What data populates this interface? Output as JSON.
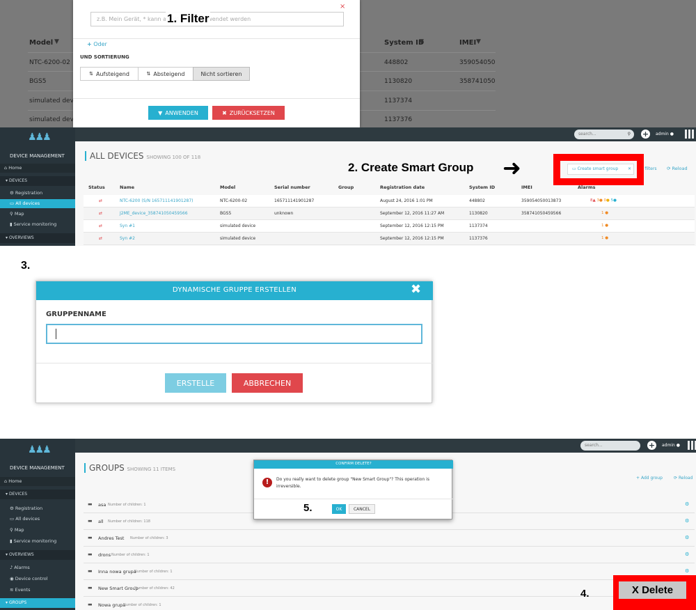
{
  "annotations": {
    "filter": "1. Filter",
    "create": "2. Create Smart Group",
    "step3": "3.",
    "step4": "4.",
    "step5": "5.",
    "delete": "X Delete"
  },
  "p1": {
    "filter_placeholder": "z.B. Mein Gerät, * kann als Wildcard verwendet werden",
    "oder": "Oder",
    "sort_label": "UND SORTIERUNG",
    "sort_asc": "Aufsteigend",
    "sort_desc": "Absteigend",
    "sort_none": "Nicht sortieren",
    "apply": "ANWENDEN",
    "reset": "ZURÜCKSETZEN",
    "bg_headers": {
      "model": "Model",
      "system_id": "System ID",
      "imei": "IMEI"
    },
    "bg_rows": [
      {
        "model": "NTC-6200-02",
        "system_id": "448802",
        "imei": "35905405001"
      },
      {
        "model": "BGS5",
        "system_id": "1130820",
        "imei": "35874105045"
      },
      {
        "model": "simulated devic",
        "system_id": "1137374",
        "imei": ""
      },
      {
        "model": "simulated devic",
        "system_id": "1137376",
        "imei": ""
      }
    ]
  },
  "p2": {
    "search_placeholder": "search...",
    "user": "admin",
    "brand": "DEVICE MANAGEMENT",
    "sidebar": {
      "home": "Home",
      "devices": "DEVICES",
      "registration": "Registration",
      "all_devices": "All devices",
      "map": "Map",
      "service": "Service monitoring",
      "overviews": "OVERVIEWS"
    },
    "title": "ALL DEVICES",
    "showing": "SHOWING 100 OF 118",
    "create_smart_group": "Create smart group",
    "filters": "r filters",
    "reload": "Reload",
    "columns": [
      "Status",
      "Name",
      "Model",
      "Serial number",
      "Group",
      "Registration date",
      "System ID",
      "IMEI",
      "Alarms"
    ],
    "rows": [
      {
        "name": "NTC-6200 (S/N 165711141901287)",
        "model": "NTC-6200-02",
        "serial": "165711141901287",
        "date": "August 24, 2016 1:01 PM",
        "sysid": "448802",
        "imei": "359054050013873",
        "alarms": [
          "8",
          "3",
          "0",
          "5"
        ]
      },
      {
        "name": "J2ME_device_358741050459566",
        "model": "BGS5",
        "serial": "unknown",
        "date": "September 12, 2016 11:27 AM",
        "sysid": "1130820",
        "imei": "358741050459566",
        "alarms": [
          "1"
        ]
      },
      {
        "name": "Syn #1",
        "model": "simulated device",
        "serial": "",
        "date": "September 12, 2016 12:15 PM",
        "sysid": "1137374",
        "imei": "",
        "alarms": [
          "1"
        ]
      },
      {
        "name": "Syn #2",
        "model": "simulated device",
        "serial": "",
        "date": "September 12, 2016 12:15 PM",
        "sysid": "1137376",
        "imei": "",
        "alarms": [
          "1"
        ]
      }
    ]
  },
  "p3": {
    "dialog_title": "DYNAMISCHE GRUPPE ERSTELLEN",
    "group_name_label": "GRUPPENNAME",
    "create": "ERSTELLE",
    "cancel": "ABBRECHEN"
  },
  "p4": {
    "search_placeholder": "search...",
    "user": "admin",
    "brand": "DEVICE MANAGEMENT",
    "sidebar": {
      "home": "Home",
      "devices": "DEVICES",
      "registration": "Registration",
      "all_devices": "All devices",
      "map": "Map",
      "service": "Service monitoring",
      "overviews": "OVERVIEWS",
      "alarms": "Alarms",
      "device_control": "Device control",
      "events": "Events",
      "groups": "GROUPS"
    },
    "title": "GROUPS",
    "showing": "SHOWING 11 ITEMS",
    "add_group": "Add group",
    "reload": "Reload",
    "groups": [
      {
        "name": "asa",
        "children": "Number of children: 1"
      },
      {
        "name": "all",
        "children": "Number of children: 118"
      },
      {
        "name": "Andres Test",
        "children": "Number of children: 3"
      },
      {
        "name": "drons",
        "children": "Number of children: 1"
      },
      {
        "name": "Inna nowa grupa",
        "children": "Number of children: 1"
      },
      {
        "name": "New Smart Group",
        "children": "Number of children: 42"
      },
      {
        "name": "Nowa grupa",
        "children": "Number of children: 1"
      }
    ],
    "confirm_title": "CONFIRM DELETE?",
    "confirm_text": "Do you really want to delete group \"New Smart Group\"? This operation is irreversible.",
    "ok": "OK",
    "cancel": "CANCEL"
  },
  "colors": {
    "teal": "#27b0d0",
    "red": "#e0474c",
    "sidebar": "#28343b",
    "highlight": "#ff0000"
  }
}
